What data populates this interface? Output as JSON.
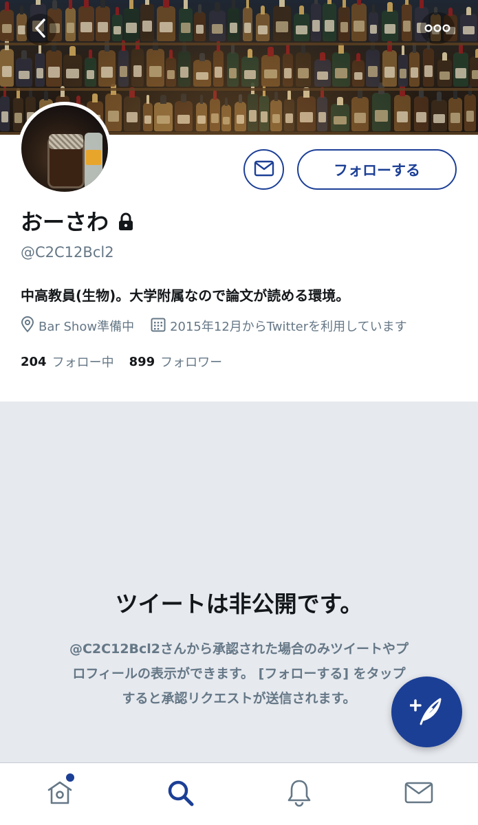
{
  "header": {
    "back_icon": "chevron-left-icon",
    "more_icon": "more-horizontal-icon"
  },
  "profile": {
    "display_name": "おーさわ",
    "handle": "@C2C12Bcl2",
    "bio": "中高教員(生物)。大学附属なので論文が読める環境。",
    "location": "Bar Show準備中",
    "joined": "2015年12月からTwitterを利用しています",
    "following_count": "204",
    "following_label": "フォロー中",
    "followers_count": "899",
    "followers_label": "フォロワー",
    "protected": true
  },
  "actions": {
    "follow_label": "フォローする",
    "dm_icon": "mail-icon"
  },
  "protected_notice": {
    "title": "ツイートは非公開です。",
    "body_line1": "@C2C12Bcl2さんから承認された場合のみツイートやプ",
    "body_line2": "ロフィールの表示ができます。 [フォローする] をタップ",
    "body_line3": "すると承認リクエストが送信されます。"
  },
  "tabs": [
    {
      "name": "home",
      "icon": "home-icon",
      "has_notification_dot": true
    },
    {
      "name": "search",
      "icon": "search-icon",
      "active": true
    },
    {
      "name": "notifications",
      "icon": "bell-icon"
    },
    {
      "name": "messages",
      "icon": "mail-icon"
    }
  ],
  "colors": {
    "accent": "#1c3f96",
    "text_primary": "#14171a",
    "text_secondary": "#657786",
    "protected_bg": "#e6e9ee"
  }
}
